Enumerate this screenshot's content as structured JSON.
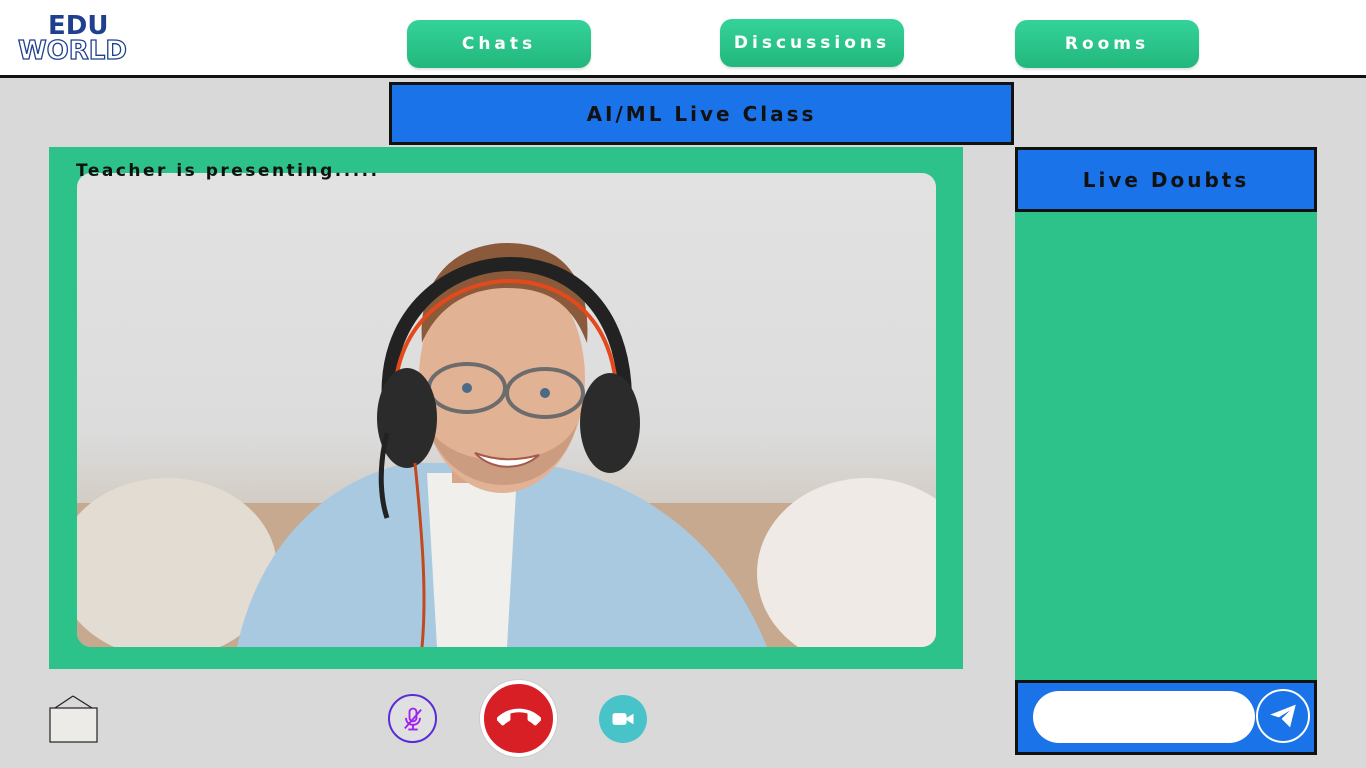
{
  "brand": {
    "line1": "EDU",
    "line2": "WORLD"
  },
  "nav": {
    "chats": "Chats",
    "discussions": "Discussions",
    "rooms": "Rooms"
  },
  "class_title": "AI/ML Live Class",
  "stage": {
    "status": "Teacher is presenting....."
  },
  "doubts": {
    "title": "Live Doubts",
    "input_placeholder": ""
  },
  "controls": {
    "mic_state": "muted",
    "icons": [
      "whiteboard-icon",
      "mic-off-icon",
      "end-call-icon",
      "video-camera-icon",
      "send-icon"
    ]
  },
  "colors": {
    "accent_green": "#2ec28b",
    "accent_blue": "#1a73e8",
    "end_call_red": "#d81f26",
    "mic_purple": "#5b2bd6",
    "cam_teal": "#48c4c9"
  }
}
